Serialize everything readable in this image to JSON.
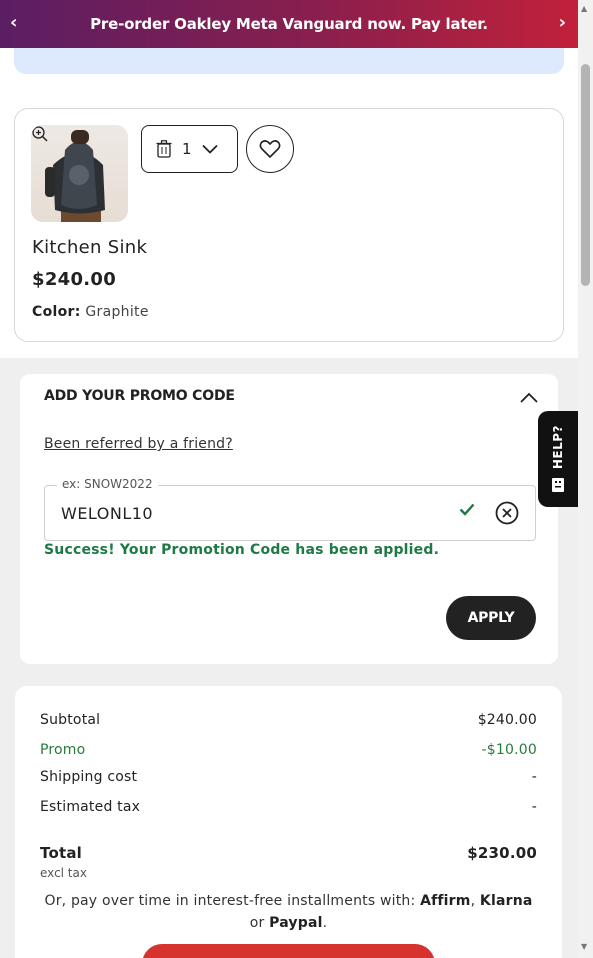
{
  "banner": {
    "text": "Pre-order Oakley Meta Vanguard now. Pay later.",
    "prev_icon": "chevron-left-icon",
    "next_icon": "chevron-right-icon"
  },
  "product": {
    "name": "Kitchen Sink",
    "price": "$240.00",
    "color_label": "Color:",
    "color_value": "Graphite",
    "quantity": "1"
  },
  "promo": {
    "title": "ADD YOUR PROMO CODE",
    "referred_link": "Been referred by a friend?",
    "field_legend": "ex: SNOW2022",
    "field_value": "WELONL10",
    "success_message": "Success! Your Promotion Code has been applied.",
    "apply_label": "APPLY"
  },
  "summary": {
    "subtotal_label": "Subtotal",
    "subtotal_value": "$240.00",
    "promo_label": "Promo",
    "promo_value": "-$10.00",
    "shipping_label": "Shipping cost",
    "shipping_value": "-",
    "tax_label": "Estimated tax",
    "tax_value": "-",
    "total_label": "Total",
    "total_value": "$230.00",
    "excl_tax": "excl tax",
    "installments_prefix": "Or, pay over time in interest-free installments with: ",
    "affirm": "Affirm",
    "sep1": ", ",
    "klarna": "Klarna",
    "sep2": " or ",
    "paypal": "Paypal",
    "end": "."
  },
  "help": {
    "label": "HELP?"
  },
  "colors": {
    "promo_green": "#1e7a44",
    "checkout_red": "#d7332e",
    "banner_start": "#5b1e63",
    "banner_end": "#c2203b"
  }
}
